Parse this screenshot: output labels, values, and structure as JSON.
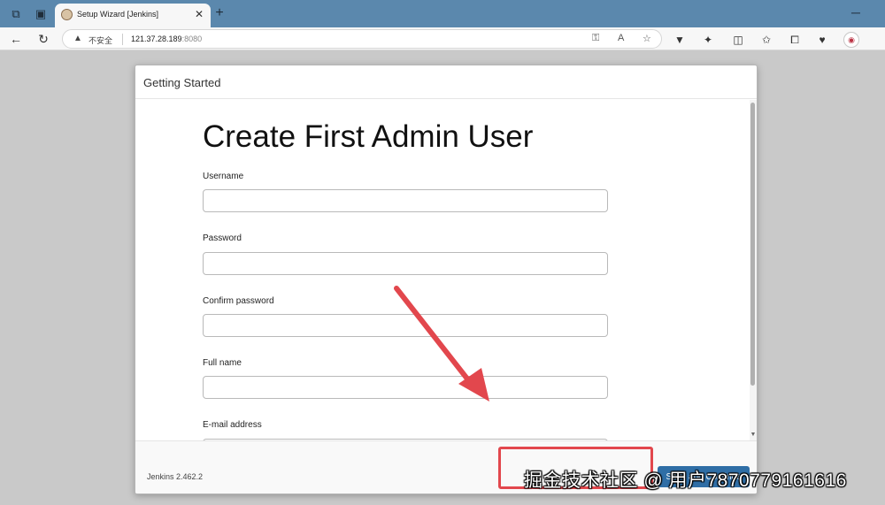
{
  "browser": {
    "tab_title": "Setup Wizard [Jenkins]",
    "tab_close": "✕",
    "new_tab": "+",
    "not_secure_label": "不安全",
    "url_host": "121.37.28.189",
    "url_port": ":8080"
  },
  "modal": {
    "title": "Getting Started",
    "heading": "Create First Admin User",
    "fields": [
      {
        "label": "Username",
        "value": ""
      },
      {
        "label": "Password",
        "value": ""
      },
      {
        "label": "Confirm password",
        "value": ""
      },
      {
        "label": "Full name",
        "value": ""
      },
      {
        "label": "E-mail address",
        "value": ""
      }
    ]
  },
  "footer": {
    "version": "Jenkins 2.462.2",
    "save_label": "Save and Continue"
  },
  "watermark": "掘金技术社区 @ 用户7870779161616",
  "colors": {
    "tabbar": "#5b88ad",
    "primary_button": "#2f6ea6",
    "annotation_red": "#e2474d"
  },
  "icons": [
    "workspaces-icon",
    "tab-actions-icon",
    "jenkins-favicon",
    "back-icon",
    "refresh-icon",
    "warning-icon",
    "key-icon",
    "read-aloud-icon",
    "favorite-icon",
    "extension-icon",
    "split-screen-icon",
    "favorites-icon",
    "collections-icon",
    "performance-icon",
    "profile-icon"
  ]
}
